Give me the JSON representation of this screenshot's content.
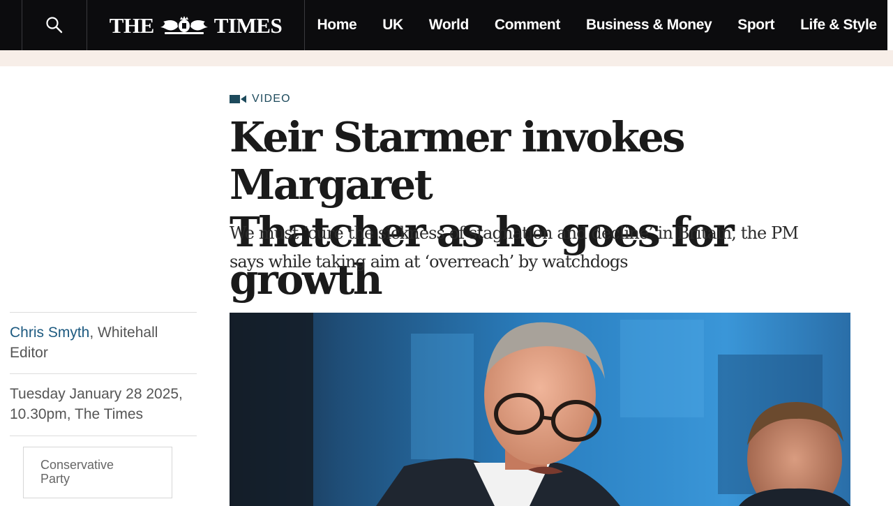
{
  "header": {
    "search_icon": "search-icon",
    "logo": {
      "left": "THE",
      "right": "TIMES",
      "emblem": "royal-crest-icon"
    },
    "nav": [
      "Home",
      "UK",
      "World",
      "Comment",
      "Business & Money",
      "Sport",
      "Life & Style"
    ]
  },
  "article": {
    "kicker": {
      "icon": "video-camera-icon",
      "label": "VIDEO"
    },
    "headline_line1": "Keir Starmer invokes Margaret",
    "headline_line2": "Thatcher as he goes for growth",
    "standfirst_line1": "We must ‘cure the sickness of stagnation and decline’ in Britain, the PM",
    "standfirst_line2": "says while taking aim at ‘overreach’ by watchdogs"
  },
  "byline": {
    "author": "Chris Smyth",
    "role_part1": ", Whitehall",
    "role_part2": "Editor"
  },
  "dateline": {
    "line1": "Tuesday January 28 2025,",
    "line2": "10.30pm, The Times"
  },
  "topic": {
    "line1": "Conservative",
    "line2": "Party"
  },
  "colors": {
    "nav_background": "#0c0c0e",
    "band": "#f7eee8",
    "accent_teal": "#1d4a5c",
    "author_link": "#1d5a80"
  }
}
